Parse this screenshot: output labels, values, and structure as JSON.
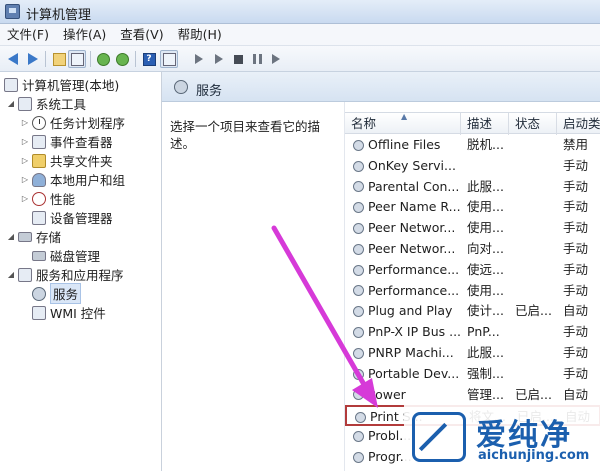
{
  "window": {
    "title": "计算机管理"
  },
  "menu": [
    "文件(F)",
    "操作(A)",
    "查看(V)",
    "帮助(H)"
  ],
  "tree": {
    "root": "计算机管理(本地)",
    "system_tools": "系统工具",
    "task_scheduler": "任务计划程序",
    "event_viewer": "事件查看器",
    "shared_folders": "共享文件夹",
    "local_users": "本地用户和组",
    "performance": "性能",
    "device_manager": "设备管理器",
    "storage": "存储",
    "disk_management": "磁盘管理",
    "services_apps": "服务和应用程序",
    "services": "服务",
    "wmi": "WMI 控件"
  },
  "header": {
    "title": "服务"
  },
  "description": "选择一个项目来查看它的描述。",
  "columns": {
    "name": "名称",
    "desc": "描述",
    "status": "状态",
    "startup": "启动类"
  },
  "services": [
    {
      "name": "Offline Files",
      "desc": "脱机...",
      "status": "",
      "startup": "禁用"
    },
    {
      "name": "OnKey Servi...",
      "desc": "",
      "status": "",
      "startup": "手动"
    },
    {
      "name": "Parental Con...",
      "desc": "此服...",
      "status": "",
      "startup": "手动"
    },
    {
      "name": "Peer Name R...",
      "desc": "使用...",
      "status": "",
      "startup": "手动"
    },
    {
      "name": "Peer Networ...",
      "desc": "使用...",
      "status": "",
      "startup": "手动"
    },
    {
      "name": "Peer Networ...",
      "desc": "向对...",
      "status": "",
      "startup": "手动"
    },
    {
      "name": "Performance...",
      "desc": "使远...",
      "status": "",
      "startup": "手动"
    },
    {
      "name": "Performance...",
      "desc": "使用...",
      "status": "",
      "startup": "手动"
    },
    {
      "name": "Plug and Play",
      "desc": "使计...",
      "status": "已启...",
      "startup": "自动"
    },
    {
      "name": "PnP-X IP Bus ...",
      "desc": "PnP...",
      "status": "",
      "startup": "手动"
    },
    {
      "name": "PNRP Machi...",
      "desc": "此服...",
      "status": "",
      "startup": "手动"
    },
    {
      "name": "Portable Dev...",
      "desc": "强制...",
      "status": "",
      "startup": "手动"
    },
    {
      "name": "Power",
      "desc": "管理...",
      "status": "已启...",
      "startup": "自动"
    },
    {
      "name": "Print S...",
      "desc": "将文...",
      "status": "已启...",
      "startup": "自动"
    },
    {
      "name": "Probl...",
      "desc": "",
      "status": "",
      "startup": ""
    },
    {
      "name": "Progr...",
      "desc": "",
      "status": "",
      "startup": ""
    }
  ],
  "watermark": {
    "cn": "爱纯净",
    "en": "aichunjing.com"
  },
  "colors": {
    "arrow": "#d63ad8",
    "highlight": "#b23b3b",
    "brand": "#1b5fae"
  }
}
